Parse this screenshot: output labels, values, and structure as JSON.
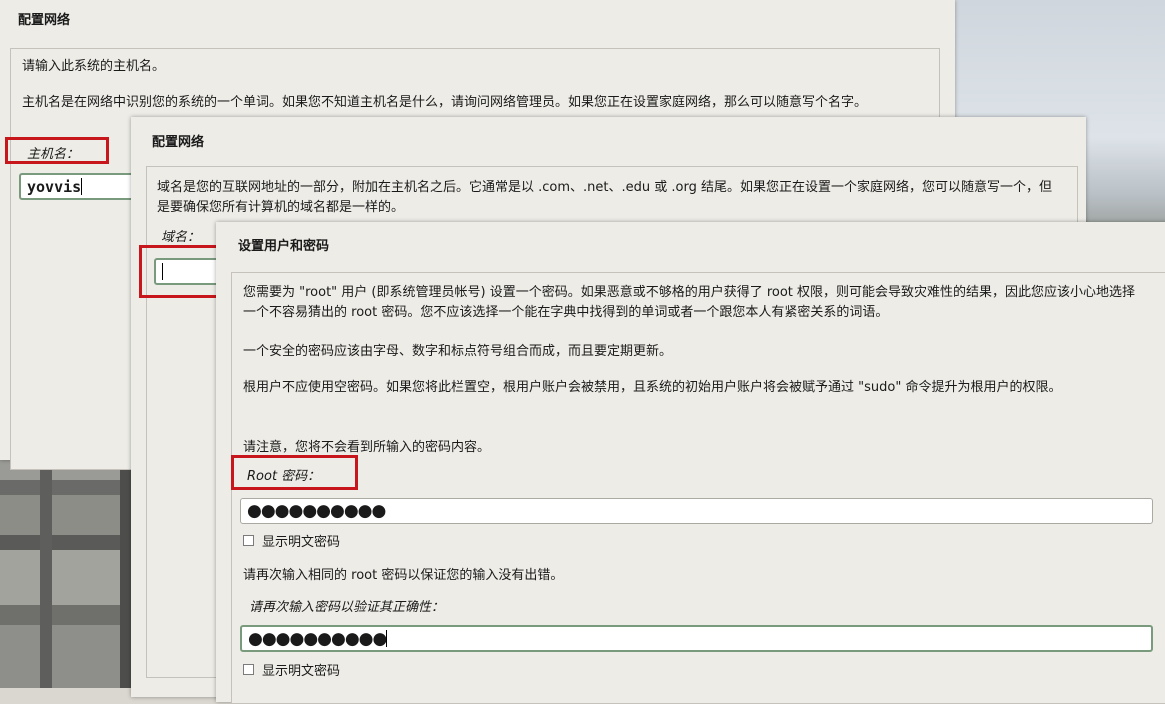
{
  "panel1": {
    "title": "配置网络",
    "intro": "请输入此系统的主机名。",
    "desc": "主机名是在网络中识别您的系统的一个单词。如果您不知道主机名是什么，请询问网络管理员。如果您正在设置家庭网络，那么可以随意写个名字。",
    "label": "主机名：",
    "value": "yovvis"
  },
  "panel2": {
    "title": "配置网络",
    "desc": "域名是您的互联网地址的一部分，附加在主机名之后。它通常是以 .com、.net、.edu 或 .org 结尾。如果您正在设置一个家庭网络，您可以随意写一个，但是要确保您所有计算机的域名都是一样的。",
    "label": "域名：",
    "value": ""
  },
  "panel3": {
    "title": "设置用户和密码",
    "para1": "您需要为 \"root\" 用户 (即系统管理员帐号) 设置一个密码。如果恶意或不够格的用户获得了 root 权限，则可能会导致灾难性的结果，因此您应该小心地选择一个不容易猜出的 root 密码。您不应该选择一个能在字典中找得到的单词或者一个跟您本人有紧密关系的词语。",
    "para2": "一个安全的密码应该由字母、数字和标点符号组合而成，而且要定期更新。",
    "para3": "根用户不应使用空密码。如果您将此栏置空，根用户账户会被禁用，且系统的初始用户账户将会被赋予通过 \"sudo\" 命令提升为根用户的权限。",
    "para4": "请注意，您将不会看到所输入的密码内容。",
    "root_label": "Root 密码：",
    "root_value": "●●●●●●●●●●",
    "show_pw_1": "显示明文密码",
    "confirm_hint": "请再次输入相同的 root 密码以保证您的输入没有出错。",
    "confirm_label": "请再次输入密码以验证其正确性：",
    "confirm_value": "●●●●●●●●●●",
    "show_pw_2": "显示明文密码"
  },
  "colors": {
    "highlight": "#c8161d",
    "panel_bg": "#edece7",
    "focus_border": "#7a9a7e"
  }
}
